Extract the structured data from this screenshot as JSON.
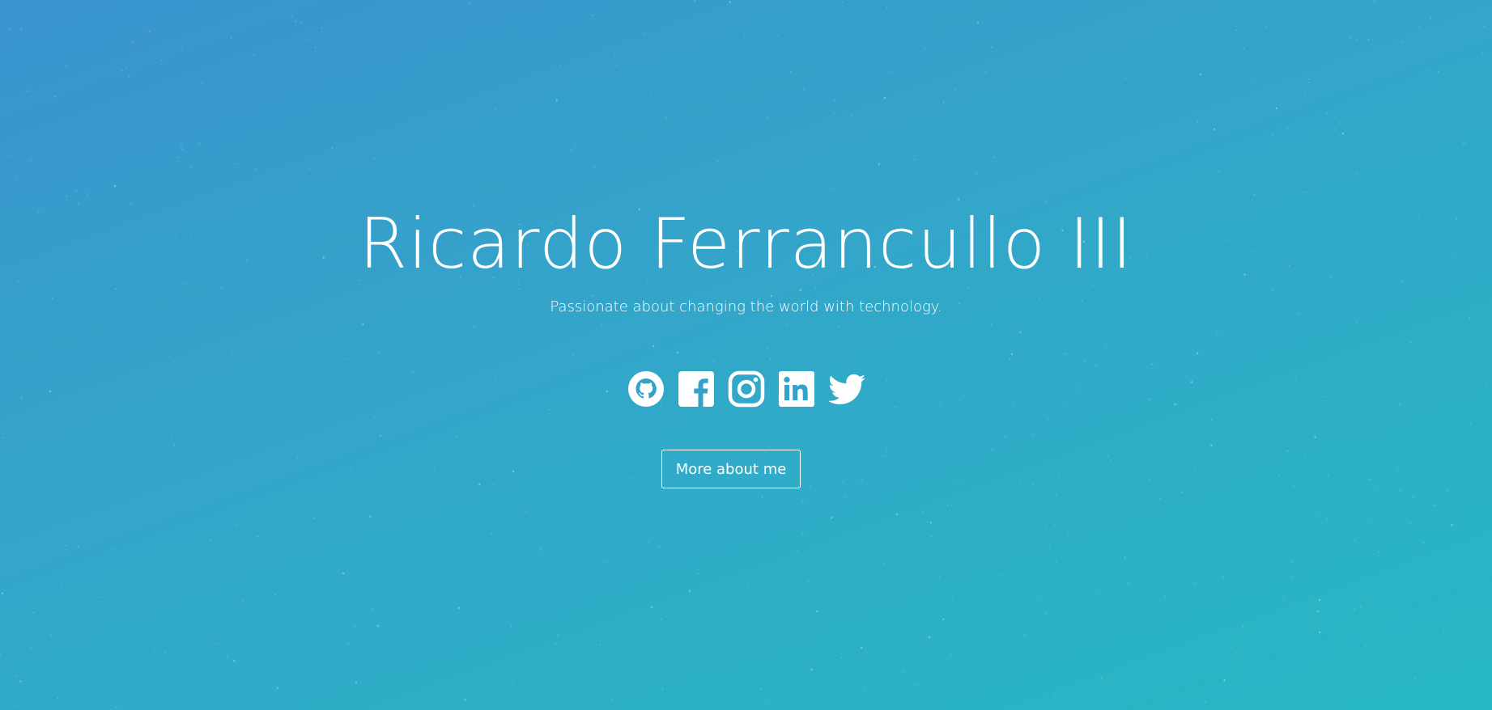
{
  "hero": {
    "name": "Ricardo Ferrancullo III",
    "tagline": "Passionate about changing the world with technology.",
    "more_button_label": "More about me"
  },
  "socials": [
    {
      "icon": "github-icon",
      "label": "GitHub"
    },
    {
      "icon": "facebook-icon",
      "label": "Facebook"
    },
    {
      "icon": "instagram-icon",
      "label": "Instagram"
    },
    {
      "icon": "linkedin-icon",
      "label": "LinkedIn"
    },
    {
      "icon": "twitter-icon",
      "label": "Twitter"
    }
  ],
  "colors": {
    "gradient_start": "#3a94cf",
    "gradient_mid": "#33a6c9",
    "gradient_end": "#27b8c4",
    "foreground": "#ffffff"
  }
}
